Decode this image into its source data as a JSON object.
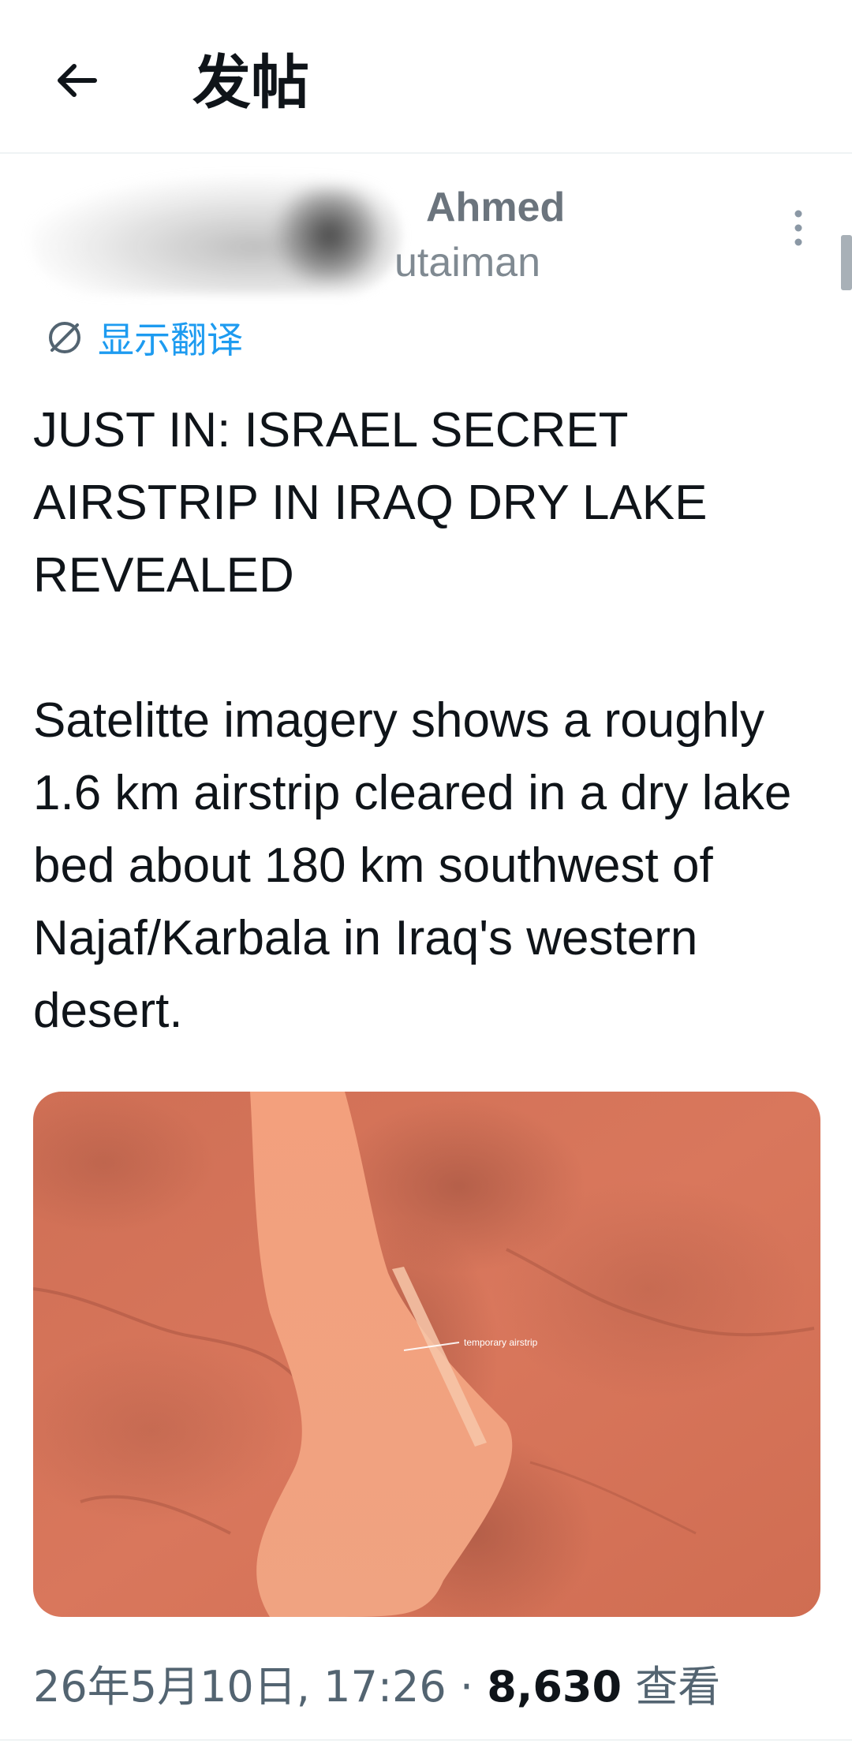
{
  "topbar": {
    "title": "发帖"
  },
  "author": {
    "display_name": "Ahmed",
    "handle": "utaiman"
  },
  "translate": {
    "label": "显示翻译"
  },
  "tweet": {
    "text": "JUST IN: ISRAEL SECRET AIRSTRIP IN IRAQ DRY LAKE REVEALED\n\nSatelitte imagery shows a roughly 1.6 km airstrip cleared in a dry lake bed about 180 km southwest of Najaf/Karbala in Iraq's western desert."
  },
  "media": {
    "annotation": "temporary airstrip"
  },
  "meta": {
    "timestamp": "26年5月10日, 17:26",
    "separator": "·",
    "views": "8,630",
    "views_label": "查看"
  },
  "icons": {
    "back": "arrow-left-icon",
    "more": "more-vertical-icon",
    "translate": "globe-icon"
  },
  "colors": {
    "accent": "#1d9bf0",
    "text": "#0f1419",
    "muted": "#536471"
  }
}
